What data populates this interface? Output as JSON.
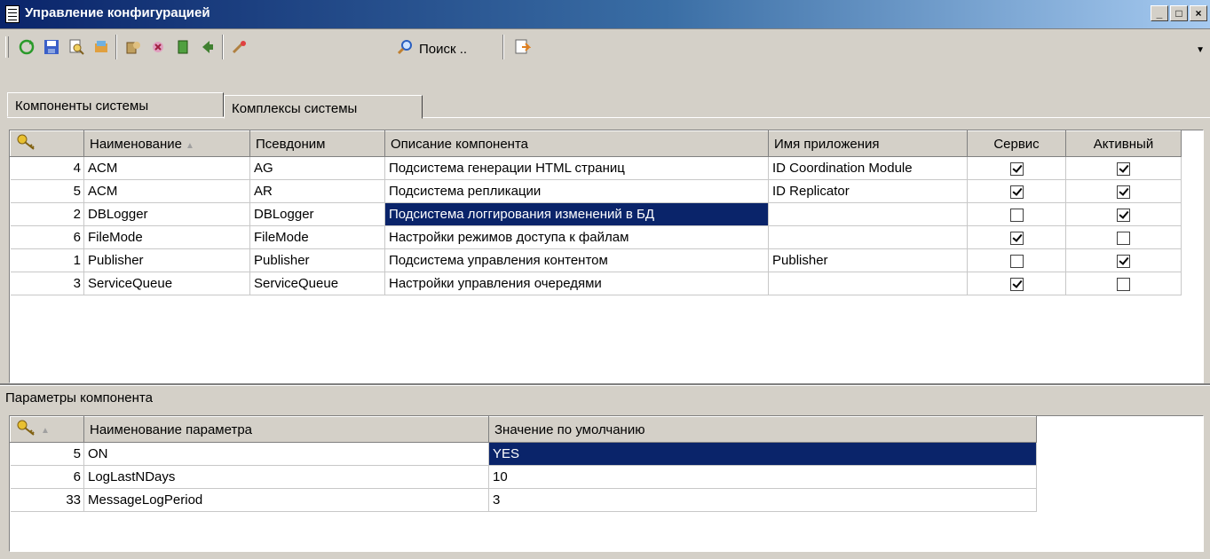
{
  "window": {
    "title": "Управление конфигурацией",
    "buttons": [
      "_",
      "□",
      "×"
    ]
  },
  "toolbar": {
    "search_label": "Поиск ..",
    "icons": [
      "refresh-icon",
      "save-icon",
      "find-icon",
      "properties-icon",
      "settings-icon",
      "remove-icon",
      "book-icon",
      "back-icon",
      "tools-icon",
      "search-icon",
      "export-icon"
    ]
  },
  "tabs": [
    {
      "label": "Компоненты системы",
      "active": true
    },
    {
      "label": "Комплексы системы",
      "active": false
    }
  ],
  "components": {
    "columns": [
      "",
      "Наименование",
      "Псевдоним",
      "Описание компонента",
      "Имя приложения",
      "Сервис",
      "Активный"
    ],
    "rows": [
      {
        "id": "4",
        "name": "ACM",
        "alias": "AG",
        "desc": "Подсистема генерации HTML страниц",
        "app": "ID Coordination Module",
        "service": true,
        "active": true
      },
      {
        "id": "5",
        "name": "ACM",
        "alias": "AR",
        "desc": "Подсистема репликации",
        "app": "ID Replicator",
        "service": true,
        "active": true
      },
      {
        "id": "2",
        "name": "DBLogger",
        "alias": "DBLogger",
        "desc": "Подсистема логгирования изменений в БД",
        "app": "",
        "service": false,
        "active": true
      },
      {
        "id": "6",
        "name": "FileMode",
        "alias": "FileMode",
        "desc": "Настройки режимов доступа к файлам",
        "app": "",
        "service": true,
        "active": false
      },
      {
        "id": "1",
        "name": "Publisher",
        "alias": "Publisher",
        "desc": "Подсистема управления контентом",
        "app": "Publisher",
        "service": false,
        "active": true
      },
      {
        "id": "3",
        "name": "ServiceQueue",
        "alias": "ServiceQueue",
        "desc": "Настройки управления очередями",
        "app": "",
        "service": true,
        "active": false
      }
    ]
  },
  "params_panel": {
    "label": "Параметры компонента",
    "columns": [
      "",
      "Наименование параметра",
      "Значение по умолчанию"
    ],
    "rows": [
      {
        "id": "5",
        "name": "ON",
        "value": "YES"
      },
      {
        "id": "6",
        "name": "LogLastNDays",
        "value": "10"
      },
      {
        "id": "33",
        "name": "MessageLogPeriod",
        "value": "3"
      }
    ]
  }
}
